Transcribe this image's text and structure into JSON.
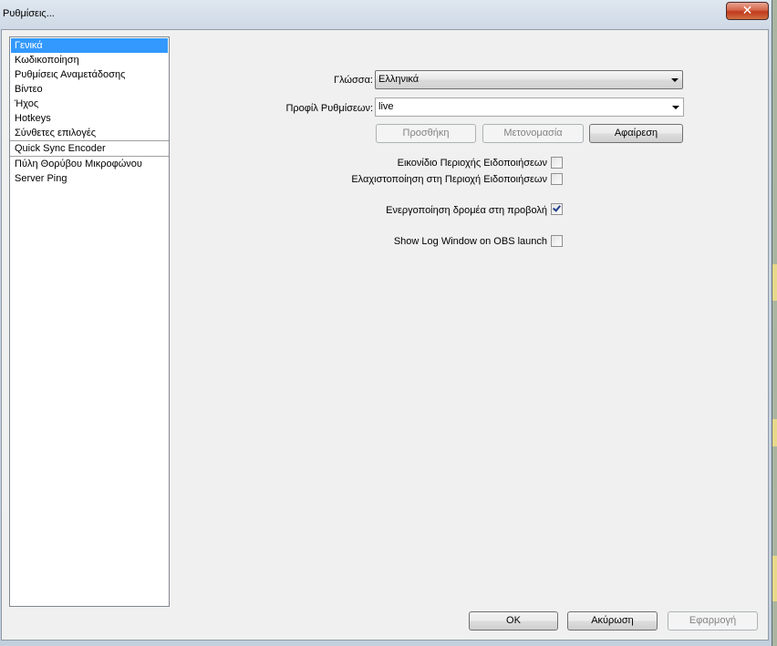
{
  "window": {
    "title": "Ρυθμίσεις...",
    "close_glyph": "✕"
  },
  "sidebar": {
    "items": [
      {
        "label": "Γενικά",
        "selected": true
      },
      {
        "label": "Κωδικοποίηση"
      },
      {
        "label": "Ρυθμίσεις Αναμετάδοσης"
      },
      {
        "label": "Βίντεο"
      },
      {
        "label": "Ήχος"
      },
      {
        "label": "Hotkeys"
      },
      {
        "label": "Σύνθετες επιλογές"
      },
      {
        "label": "Quick Sync Encoder"
      },
      {
        "label": "Πύλη Θορύβου Μικροφώνου"
      },
      {
        "label": "Server Ping"
      }
    ]
  },
  "general": {
    "language_label": "Γλώσσα:",
    "language_value": "Ελληνικά",
    "profile_label": "Προφίλ Ρυθμίσεων:",
    "profile_value": "live",
    "add_label": "Προσθήκη",
    "rename_label": "Μετονομασία",
    "remove_label": "Αφαίρεση",
    "tray_icon_label": "Εικονίδιο Περιοχής Ειδοποιήσεων",
    "tray_icon_checked": false,
    "minimize_tray_label": "Ελαχιστοποίηση στη Περιοχή Ειδοποιήσεων",
    "minimize_tray_checked": false,
    "cursor_label": "Ενεργοποίηση δρομέα στη προβολή",
    "cursor_checked": true,
    "log_window_label": "Show Log Window on OBS launch",
    "log_window_checked": false
  },
  "footer": {
    "ok_label": "OK",
    "cancel_label": "Ακύρωση",
    "apply_label": "Εφαρμογή"
  },
  "colors": {
    "selection": "#3399ff",
    "close_button": "#c0391e"
  }
}
